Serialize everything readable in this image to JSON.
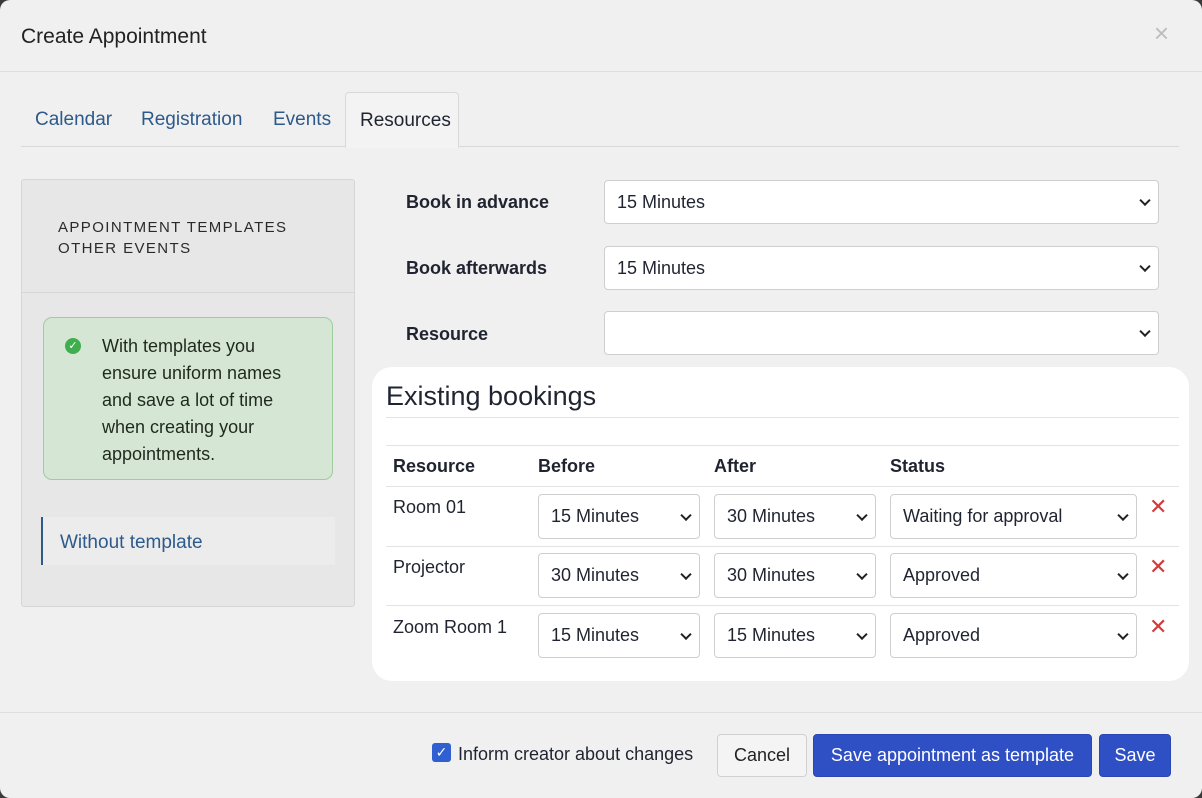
{
  "dialog": {
    "title": "Create Appointment",
    "close_glyph": "×"
  },
  "tabs": [
    {
      "label": "Calendar"
    },
    {
      "label": "Registration"
    },
    {
      "label": "Events"
    },
    {
      "label": "Resources",
      "active": true
    }
  ],
  "sidebar": {
    "heading_line1": "APPOINTMENT TEMPLATES",
    "heading_line2": "OTHER EVENTS",
    "info_text": "With templates you ensure uniform names and save a lot of time when creating your appointments.",
    "info_icon": "check-circle-icon",
    "without_template": "Without template"
  },
  "form": {
    "book_in_advance": {
      "label": "Book in advance",
      "value": "15 Minutes"
    },
    "book_afterwards": {
      "label": "Book afterwards",
      "value": "15 Minutes"
    },
    "resource": {
      "label": "Resource",
      "value": ""
    }
  },
  "bookings": {
    "title": "Existing bookings",
    "headers": {
      "resource": "Resource",
      "before": "Before",
      "after": "After",
      "status": "Status"
    },
    "rows": [
      {
        "resource": "Room 01",
        "before": "15 Minutes",
        "after": "30 Minutes",
        "status": "Waiting for approval"
      },
      {
        "resource": "Projector",
        "before": "30 Minutes",
        "after": "30 Minutes",
        "status": "Approved"
      },
      {
        "resource": "Zoom Room 1",
        "before": "15 Minutes",
        "after": "15 Minutes",
        "status": "Approved"
      }
    ],
    "delete_glyph": "✕",
    "delete_color": "#d43a3a"
  },
  "footer": {
    "inform_label": "Inform creator about changes",
    "inform_checked": true,
    "cancel_label": "Cancel",
    "save_template_label": "Save appointment as template",
    "save_label": "Save"
  },
  "colors": {
    "primary": "#2f4fc4",
    "link": "#2d5a8a",
    "success_bg": "#d5e6d4"
  }
}
